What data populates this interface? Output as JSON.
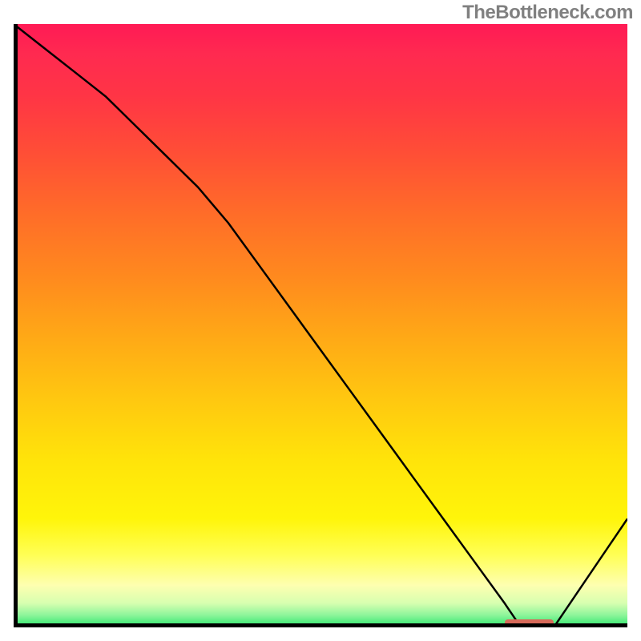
{
  "watermark": "TheBottleneck.com",
  "colors": {
    "curve": "#000000",
    "axis": "#000000",
    "marker": "#d76a5a",
    "gradient_top": "#ff1a55",
    "gradient_bottom": "#28e66a"
  },
  "chart_data": {
    "type": "line",
    "title": "",
    "xlabel": "",
    "ylabel": "",
    "xlim": [
      0,
      100
    ],
    "ylim": [
      0,
      100
    ],
    "x": [
      0,
      5,
      10,
      15,
      20,
      25,
      30,
      35,
      40,
      45,
      50,
      55,
      60,
      65,
      70,
      75,
      80,
      82,
      85,
      88,
      92,
      100
    ],
    "values": [
      100,
      96,
      92,
      88,
      83,
      78,
      73,
      67,
      60,
      53,
      46,
      39,
      32,
      25,
      18,
      11,
      4,
      1,
      0,
      0,
      6,
      18
    ],
    "marker": {
      "x_start": 80,
      "x_end": 88,
      "y": 0.6
    }
  }
}
